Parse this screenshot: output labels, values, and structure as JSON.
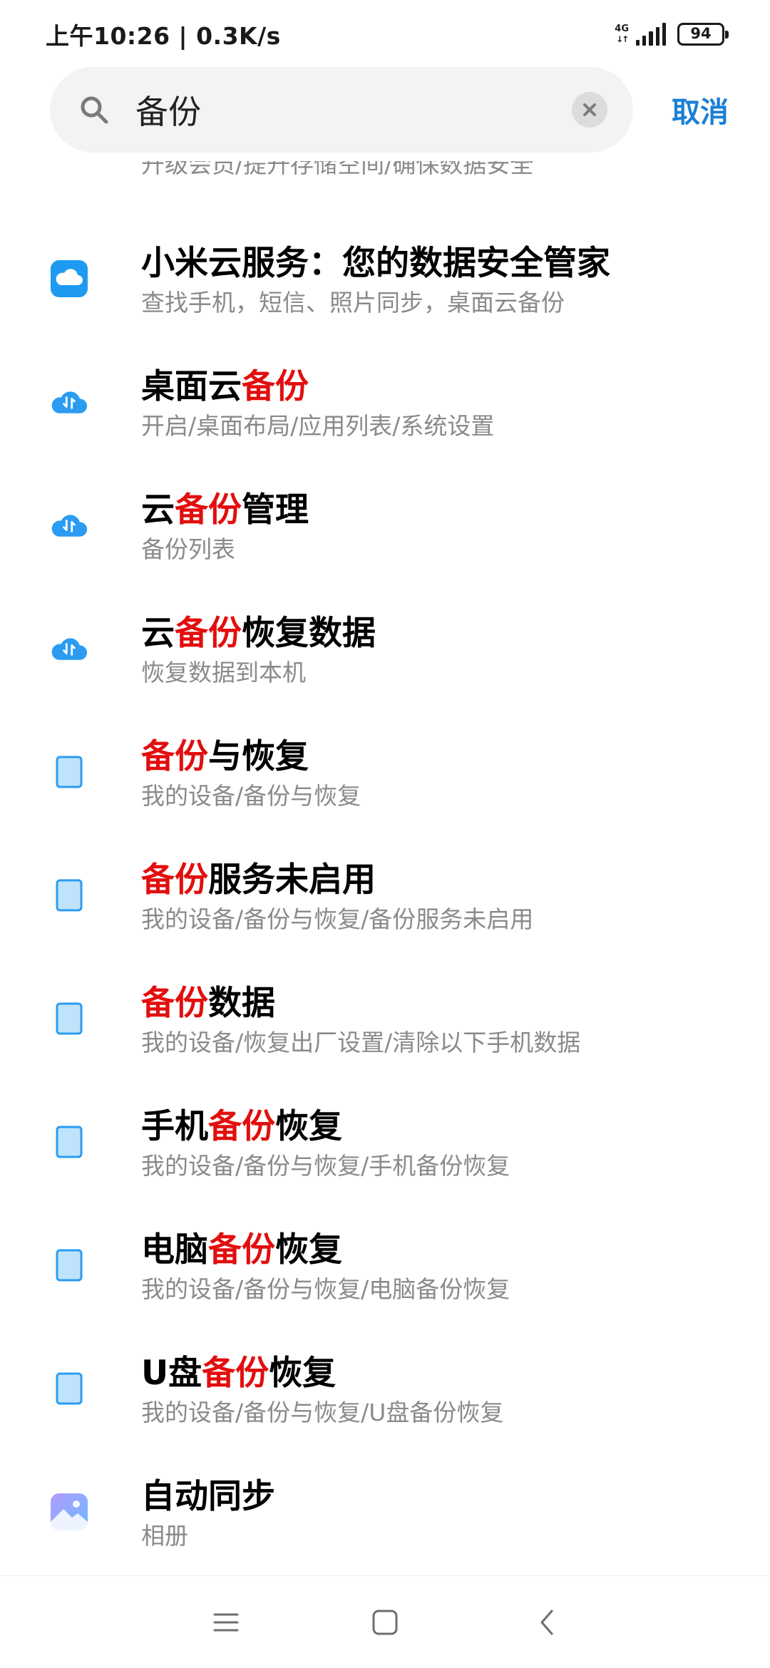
{
  "status_bar": {
    "time": "上午10:26 | 0.3K/s",
    "network_type": "4G",
    "network_arrows": "↓↑",
    "battery": "94"
  },
  "search": {
    "query": "备份",
    "cancel_label": "取消"
  },
  "partial_item": {
    "subtitle": "升级会员/提升存储空间/确保数据安全"
  },
  "colors": {
    "highlight": "#e20e0e",
    "accent": "#1a7fd6",
    "subtitle": "#8a8a8a"
  },
  "results": [
    {
      "icon": "xiaomi-cloud-icon",
      "title_pre": "小米云服务：您的数据安全管家",
      "title_hl": "",
      "title_post": "",
      "subtitle": "查找手机，短信、照片同步，桌面云备份"
    },
    {
      "icon": "cloud-sync-icon",
      "title_pre": "桌面云",
      "title_hl": "备份",
      "title_post": "",
      "subtitle": "开启/桌面布局/应用列表/系统设置"
    },
    {
      "icon": "cloud-sync-icon",
      "title_pre": "云",
      "title_hl": "备份",
      "title_post": "管理",
      "subtitle": "备份列表"
    },
    {
      "icon": "cloud-sync-icon",
      "title_pre": "云",
      "title_hl": "备份",
      "title_post": "恢复数据",
      "subtitle": "恢复数据到本机"
    },
    {
      "icon": "device-icon",
      "title_pre": "",
      "title_hl": "备份",
      "title_post": "与恢复",
      "subtitle": "我的设备/备份与恢复"
    },
    {
      "icon": "device-icon",
      "title_pre": "",
      "title_hl": "备份",
      "title_post": "服务未启用",
      "subtitle": "我的设备/备份与恢复/备份服务未启用"
    },
    {
      "icon": "device-icon",
      "title_pre": "",
      "title_hl": "备份",
      "title_post": "数据",
      "subtitle": "我的设备/恢复出厂设置/清除以下手机数据"
    },
    {
      "icon": "device-icon",
      "title_pre": "手机",
      "title_hl": "备份",
      "title_post": "恢复",
      "subtitle": "我的设备/备份与恢复/手机备份恢复"
    },
    {
      "icon": "device-icon",
      "title_pre": "电脑",
      "title_hl": "备份",
      "title_post": "恢复",
      "subtitle": "我的设备/备份与恢复/电脑备份恢复"
    },
    {
      "icon": "device-icon",
      "title_pre": "U盘",
      "title_hl": "备份",
      "title_post": "恢复",
      "subtitle": "我的设备/备份与恢复/U盘备份恢复"
    },
    {
      "icon": "gallery-icon",
      "title_pre": "自动同步",
      "title_hl": "",
      "title_post": "",
      "subtitle": "相册"
    }
  ],
  "nav": {
    "menu_icon": "menu-icon",
    "home_icon": "home-icon",
    "back_icon": "back-icon"
  }
}
